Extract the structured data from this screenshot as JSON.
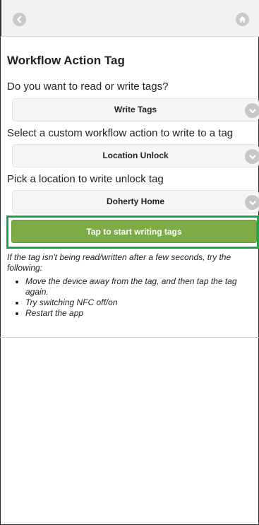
{
  "header": {
    "back_icon": "chevron-left-icon",
    "home_icon": "home-icon"
  },
  "page": {
    "title": "Workflow Action Tag"
  },
  "mode": {
    "question": "Do you want to read or write tags?",
    "selected": "Write Tags"
  },
  "action": {
    "question": "Select a custom workflow action to write to a tag",
    "selected": "Location Unlock"
  },
  "location": {
    "question": "Pick a location to write unlock tag",
    "selected": "Doherty Home"
  },
  "start_button": {
    "label": "Tap to start writing tags"
  },
  "help": {
    "intro": "If the tag isn't being read/written after a few seconds, try the following:",
    "tips": [
      "Move the device away from the tag, and then tap the tag again.",
      "Try switching NFC off/on",
      "Restart the app"
    ]
  },
  "colors": {
    "button": "#7dab45",
    "highlight": "#1ea54b"
  }
}
